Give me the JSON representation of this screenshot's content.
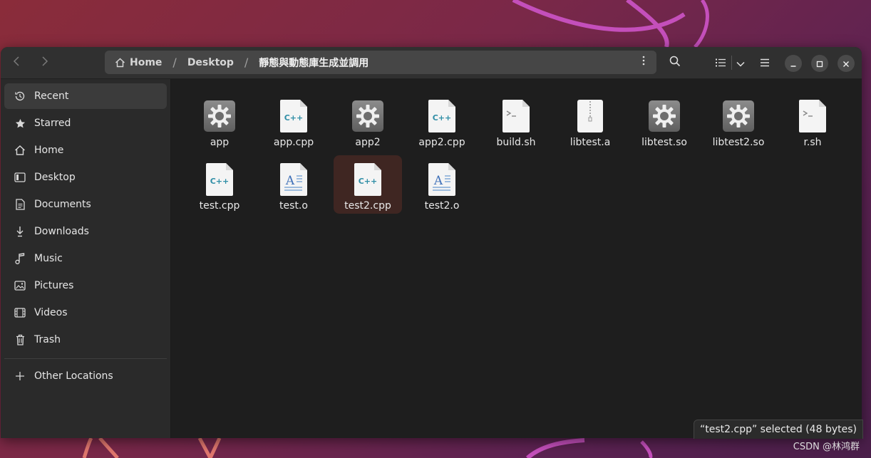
{
  "breadcrumb": {
    "items": [
      {
        "label": "Home",
        "icon": "home-icon"
      },
      {
        "label": "Desktop"
      },
      {
        "label": "靜態與動態庫生成並調用"
      }
    ],
    "separator": "/"
  },
  "sidebar": {
    "items": [
      {
        "label": "Recent",
        "icon": "clock-icon",
        "active": true
      },
      {
        "label": "Starred",
        "icon": "star-icon"
      },
      {
        "label": "Home",
        "icon": "home-icon"
      },
      {
        "label": "Desktop",
        "icon": "desktop-icon"
      },
      {
        "label": "Documents",
        "icon": "document-icon"
      },
      {
        "label": "Downloads",
        "icon": "download-icon"
      },
      {
        "label": "Music",
        "icon": "music-icon"
      },
      {
        "label": "Pictures",
        "icon": "picture-icon"
      },
      {
        "label": "Videos",
        "icon": "video-icon"
      },
      {
        "label": "Trash",
        "icon": "trash-icon"
      }
    ],
    "other_locations": {
      "label": "Other Locations",
      "icon": "plus-icon"
    }
  },
  "files": [
    {
      "name": "app",
      "type": "executable"
    },
    {
      "name": "app.cpp",
      "type": "cpp"
    },
    {
      "name": "app2",
      "type": "executable"
    },
    {
      "name": "app2.cpp",
      "type": "cpp"
    },
    {
      "name": "build.sh",
      "type": "script"
    },
    {
      "name": "libtest.a",
      "type": "archive"
    },
    {
      "name": "libtest.so",
      "type": "executable"
    },
    {
      "name": "libtest2.so",
      "type": "executable"
    },
    {
      "name": "r.sh",
      "type": "script"
    },
    {
      "name": "test.cpp",
      "type": "cpp"
    },
    {
      "name": "test.o",
      "type": "object"
    },
    {
      "name": "test2.cpp",
      "type": "cpp",
      "selected": true
    },
    {
      "name": "test2.o",
      "type": "object"
    }
  ],
  "status_text": "“test2.cpp” selected  (48 bytes)",
  "watermark": "CSDN @林鸿群",
  "colors": {
    "selection": "#3f2622",
    "sidebar_active": "#3b3b3b",
    "cpp_text": "#2f8ea6",
    "object_text": "#3f70b8"
  }
}
